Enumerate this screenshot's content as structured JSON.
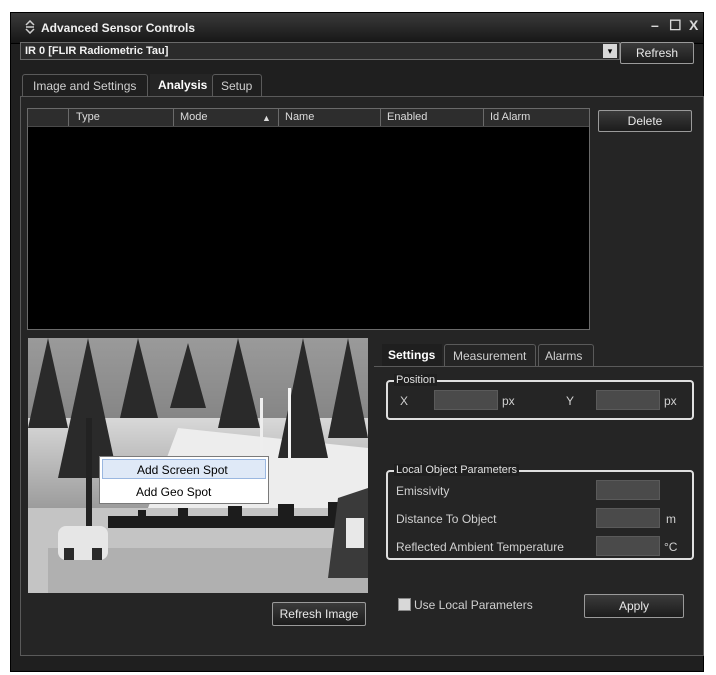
{
  "window": {
    "title": "Advanced Sensor Controls",
    "minimize": "–",
    "maximize": "☐",
    "close": "X"
  },
  "device": {
    "selected": "IR 0 [FLIR Radiometric Tau]",
    "arrow": "▾"
  },
  "refresh_label": "Refresh",
  "tabs": [
    "Image and Settings",
    "Analysis",
    "Setup"
  ],
  "active_tab": "Analysis",
  "grid": {
    "columns": [
      "Type",
      "Mode",
      "Name",
      "Enabled",
      "Id Alarm"
    ],
    "sort_indicator": "▲"
  },
  "delete_label": "Delete",
  "context_menu": {
    "items": [
      "Add Screen Spot",
      "Add Geo Spot"
    ],
    "highlighted": "Add Screen Spot"
  },
  "refresh_image_label": "Refresh Image",
  "settings_tabs": [
    "Settings",
    "Measurement",
    "Alarms"
  ],
  "active_settings_tab": "Settings",
  "position": {
    "title": "Position",
    "x_label": "X",
    "y_label": "Y",
    "x_value": "",
    "y_value": "",
    "unit": "px"
  },
  "local_params": {
    "title": "Local Object Parameters",
    "emissivity_label": "Emissivity",
    "emissivity_value": "",
    "distance_label": "Distance To Object",
    "distance_value": "",
    "distance_unit": "m",
    "reflected_label": "Reflected Ambient Temperature",
    "reflected_value": "",
    "reflected_unit": "°C"
  },
  "use_local_label": "Use Local Parameters",
  "use_local_checked": false,
  "apply_label": "Apply",
  "colors": {
    "window_bg": "#1f1f1f",
    "image_bg": "#6e6e6e",
    "menu_highlight": "#dfe9f7"
  }
}
